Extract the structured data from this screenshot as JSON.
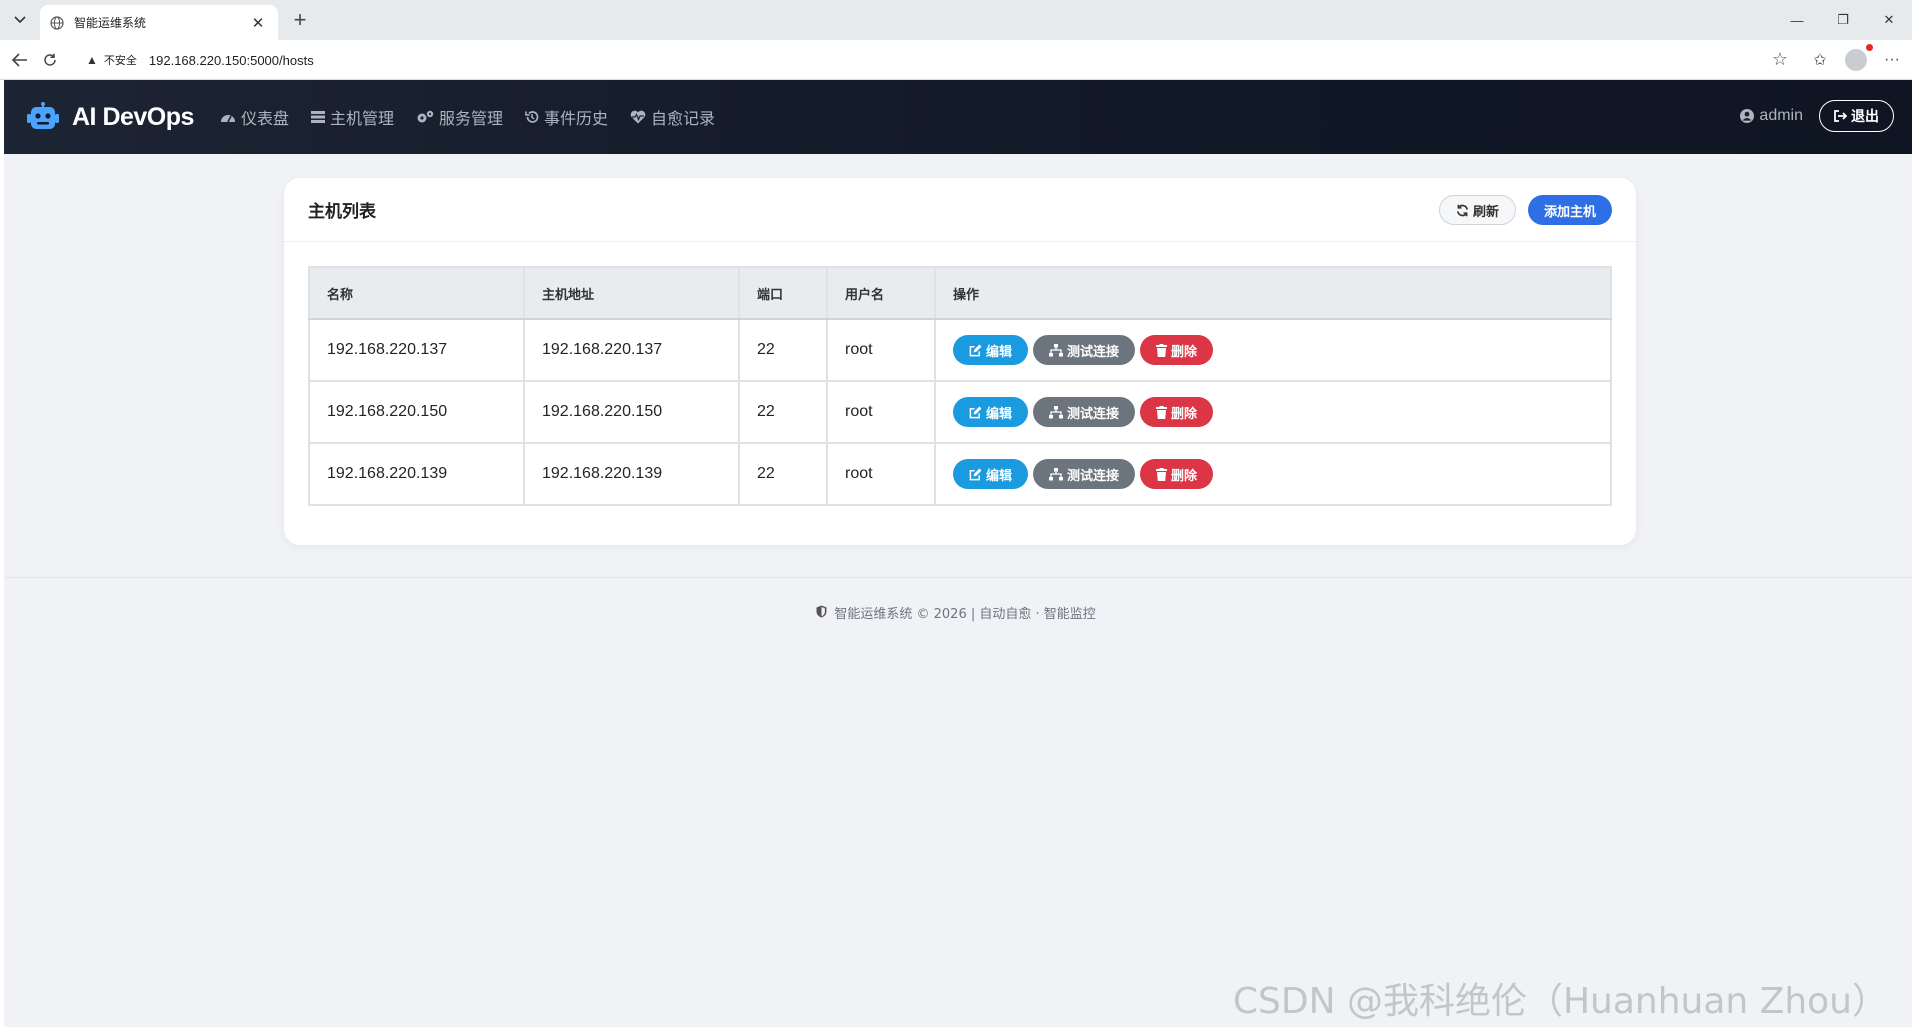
{
  "browser": {
    "tab_title": "智能运维系统",
    "insecure_label": "不安全",
    "url": "192.168.220.150:5000/hosts"
  },
  "app": {
    "brand": "AI DevOps",
    "nav": [
      "仪表盘",
      "主机管理",
      "服务管理",
      "事件历史",
      "自愈记录"
    ],
    "user": "admin",
    "logout": "退出"
  },
  "card": {
    "title": "主机列表",
    "refresh_label": "刷新",
    "add_label": "添加主机"
  },
  "table": {
    "headers": [
      "名称",
      "主机地址",
      "端口",
      "用户名",
      "操作"
    ],
    "rows": [
      [
        "192.168.220.137",
        "192.168.220.137",
        "22",
        "root"
      ],
      [
        "192.168.220.150",
        "192.168.220.150",
        "22",
        "root"
      ],
      [
        "192.168.220.139",
        "192.168.220.139",
        "22",
        "root"
      ]
    ],
    "actions": {
      "edit": "编辑",
      "test": "测试连接",
      "delete": "删除"
    }
  },
  "footer": {
    "text": "智能运维系统 © 2026 | 自动自愈 · 智能监控"
  },
  "watermark": "CSDN @我科绝伦（Huanhuan Zhou）",
  "colors": {
    "navbar": "#111827",
    "primary": "#2f6fe6",
    "edit": "#1a9be0",
    "test": "#6c757d",
    "delete": "#dc3545",
    "background": "#f0f2f5"
  }
}
